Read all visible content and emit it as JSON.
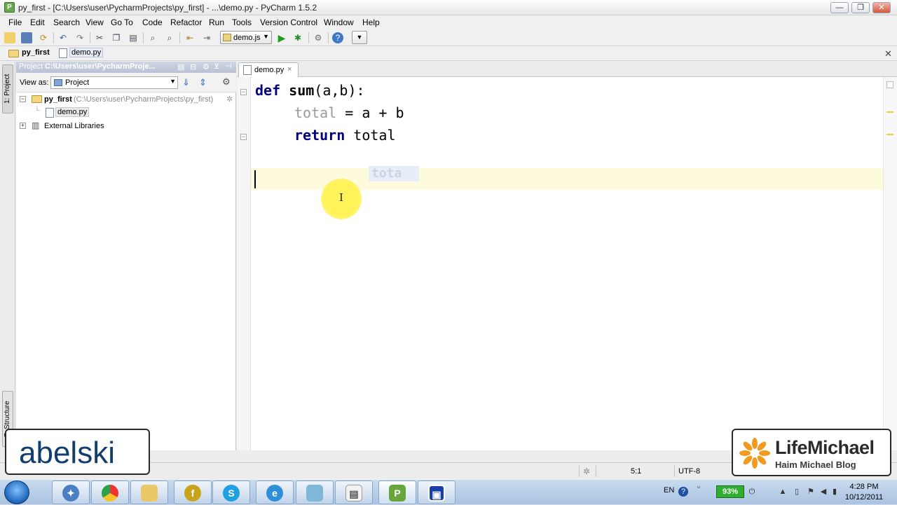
{
  "window": {
    "title": "py_first - [C:\\Users\\user\\PycharmProjects\\py_first] - ...\\demo.py - PyCharm 1.5.2"
  },
  "menu": [
    "File",
    "Edit",
    "Search",
    "View",
    "Go To",
    "Code",
    "Refactor",
    "Run",
    "Tools",
    "Version Control",
    "Window",
    "Help"
  ],
  "toolbar": {
    "run_config": "demo.js"
  },
  "navbar": {
    "project": "py_first",
    "file": "demo.py"
  },
  "left_strip": {
    "project_tab": "1: Project",
    "structure_tab": "7: Structure"
  },
  "project_panel": {
    "header_label": "Project",
    "header_path": "C:\\Users\\user\\PycharmProje...",
    "view_as_label": "View as:",
    "view_as_value": "Project",
    "tree": [
      {
        "name": "py_first",
        "hint": "(C:\\Users\\user\\PycharmProjects\\py_first)"
      },
      {
        "name": "demo.py"
      },
      {
        "name": "External Libraries"
      }
    ]
  },
  "editor": {
    "tab": "demo.py",
    "tab_close": "×",
    "lines": [
      {
        "kw": "def",
        "fn": "sum",
        "rest": "(a,b):"
      },
      {
        "var": "total",
        "rest": " = a + b"
      },
      {
        "kw": "return",
        "rest": " total"
      }
    ],
    "ghost_text": "tota"
  },
  "status": {
    "position": "5:1",
    "encoding": "UTF-8"
  },
  "overlays": {
    "left_logo": "abelski",
    "right_logo_title": "LifeMichael",
    "right_logo_subtitle": "Haim Michael Blog"
  },
  "taskbar": {
    "lang": "EN",
    "battery": "93%",
    "time": "4:28 PM",
    "date": "10/12/2011"
  },
  "colors": {
    "keyword": "#000080",
    "current_line": "#fdfbdc",
    "cursor_highlight": "#fff35a",
    "battery": "#2fae2f"
  }
}
